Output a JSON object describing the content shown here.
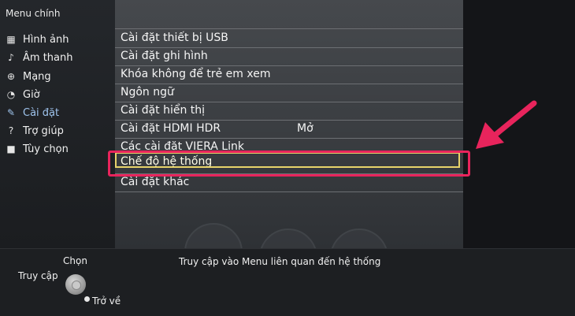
{
  "sidebar": {
    "title": "Menu chính",
    "items": [
      {
        "label": "Hình ảnh",
        "icon": "picture-icon",
        "glyph": "▦"
      },
      {
        "label": "Âm thanh",
        "icon": "music-note-icon",
        "glyph": "♪"
      },
      {
        "label": "Mạng",
        "icon": "globe-icon",
        "glyph": "⊕"
      },
      {
        "label": "Giờ",
        "icon": "clock-icon",
        "glyph": "◔"
      },
      {
        "label": "Cài đặt",
        "icon": "wrench-icon",
        "glyph": "✎",
        "active": true
      },
      {
        "label": "Trợ giúp",
        "icon": "question-icon",
        "glyph": "?"
      },
      {
        "label": "Tùy chọn",
        "icon": "options-icon",
        "glyph": "■"
      }
    ]
  },
  "settings_menu": {
    "rows": [
      {
        "label": "Cài đặt thiết bị USB",
        "value": ""
      },
      {
        "label": "Cài đặt ghi hình",
        "value": ""
      },
      {
        "label": "Khóa không để trẻ em xem",
        "value": ""
      },
      {
        "label": "Ngôn ngữ",
        "value": ""
      },
      {
        "label": "Cài đặt hiển thị",
        "value": ""
      },
      {
        "label": "Cài đặt HDMI HDR",
        "value": "Mở"
      },
      {
        "label": "Các cài đặt VIERA Link",
        "value": ""
      },
      {
        "label": "Chế độ hệ thống",
        "value": "",
        "selected": true
      },
      {
        "label": "Cài đặt khác",
        "value": ""
      }
    ]
  },
  "bottom_bar": {
    "hint": "Truy cập vào Menu liên quan đến hệ thống",
    "select_label": "Chọn",
    "access_label": "Truy cập",
    "return_label": "Trở về"
  },
  "colors": {
    "highlight_frame": "#e8245c",
    "selection_border": "#e7d36a",
    "active_item": "#9fc4ee"
  }
}
